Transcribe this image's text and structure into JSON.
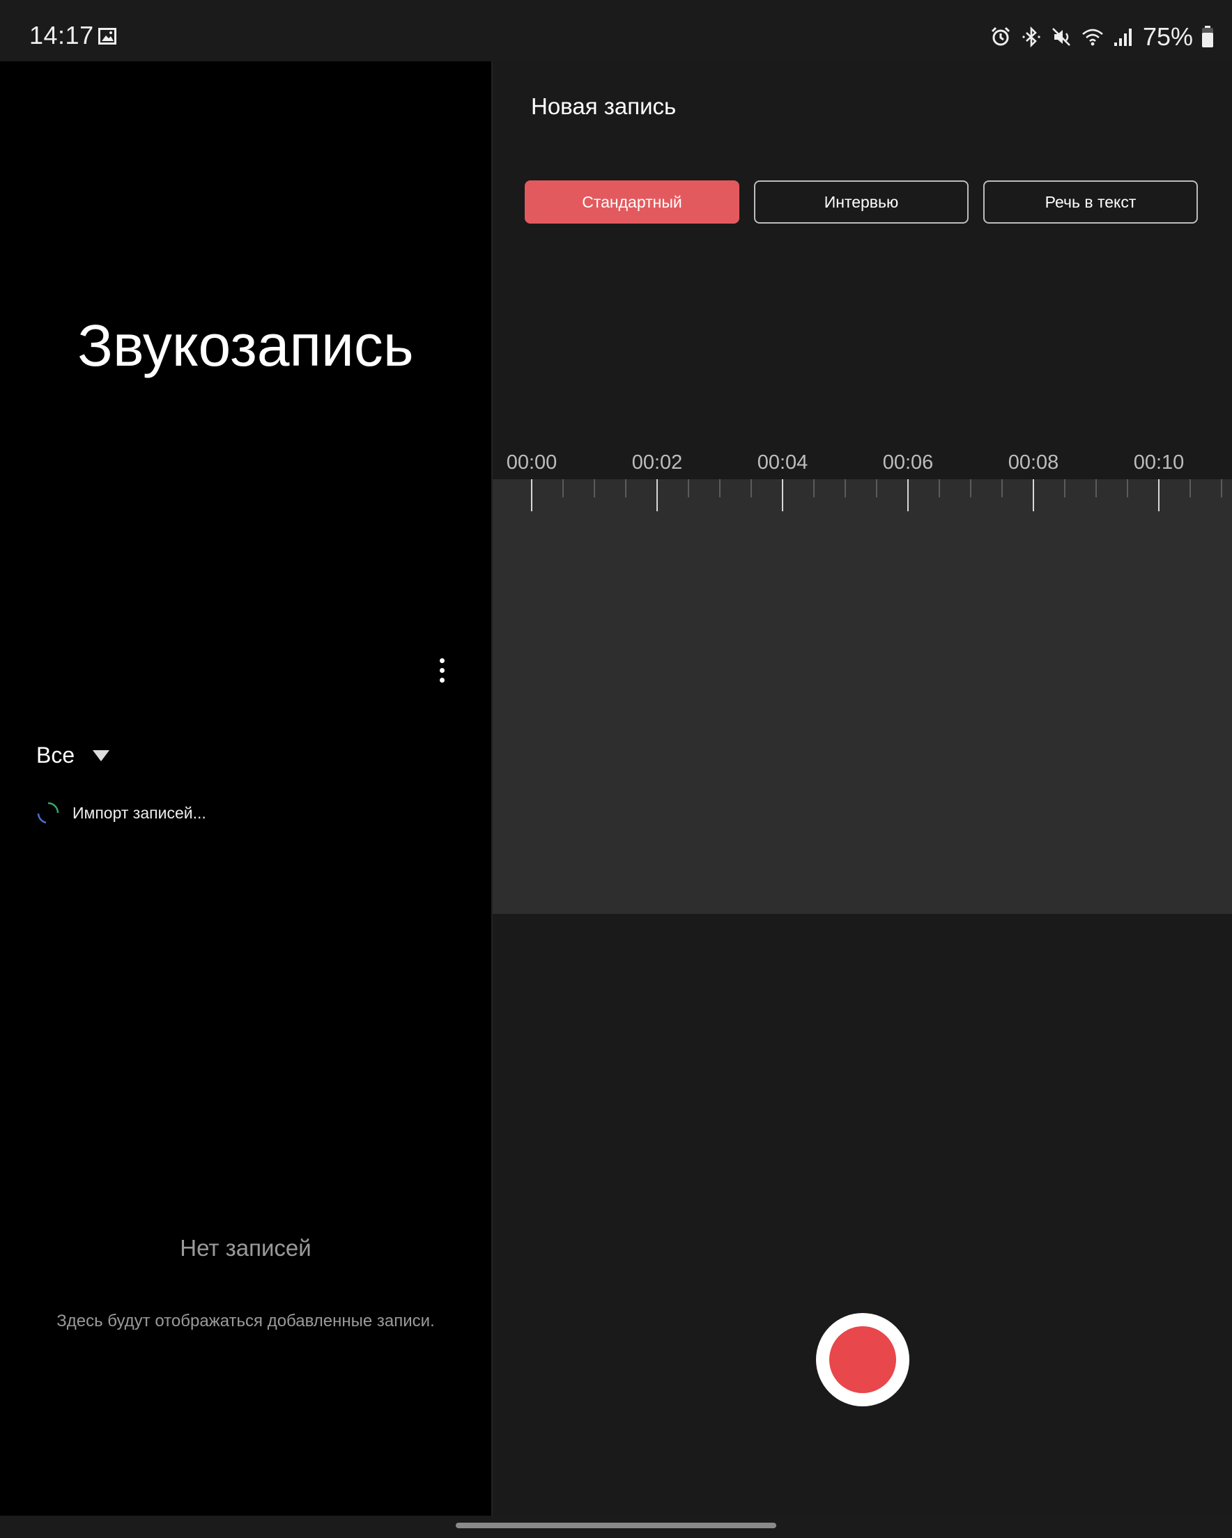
{
  "status_bar": {
    "time": "14:17",
    "battery_percent": "75%",
    "battery_level": 0.75,
    "icons": [
      "gallery-icon",
      "alarm-icon",
      "bluetooth-icon",
      "mute-icon",
      "wifi-icon",
      "signal-icon",
      "battery-icon"
    ]
  },
  "sidebar": {
    "app_title": "Звукозапись",
    "filter_label": "Все",
    "import_status": "Импорт записей...",
    "empty_title": "Нет записей",
    "empty_subtitle": "Здесь будут отображаться добавленные записи."
  },
  "recorder": {
    "title": "Новая запись",
    "modes": [
      {
        "label": "Стандартный",
        "active": true
      },
      {
        "label": "Интервью",
        "active": false
      },
      {
        "label": "Речь в текст",
        "active": false
      }
    ],
    "timeline": [
      "00:00",
      "00:02",
      "00:04",
      "00:06",
      "00:08",
      "00:10"
    ]
  },
  "colors": {
    "accent": "#e35a5e",
    "record": "#e8474b"
  }
}
